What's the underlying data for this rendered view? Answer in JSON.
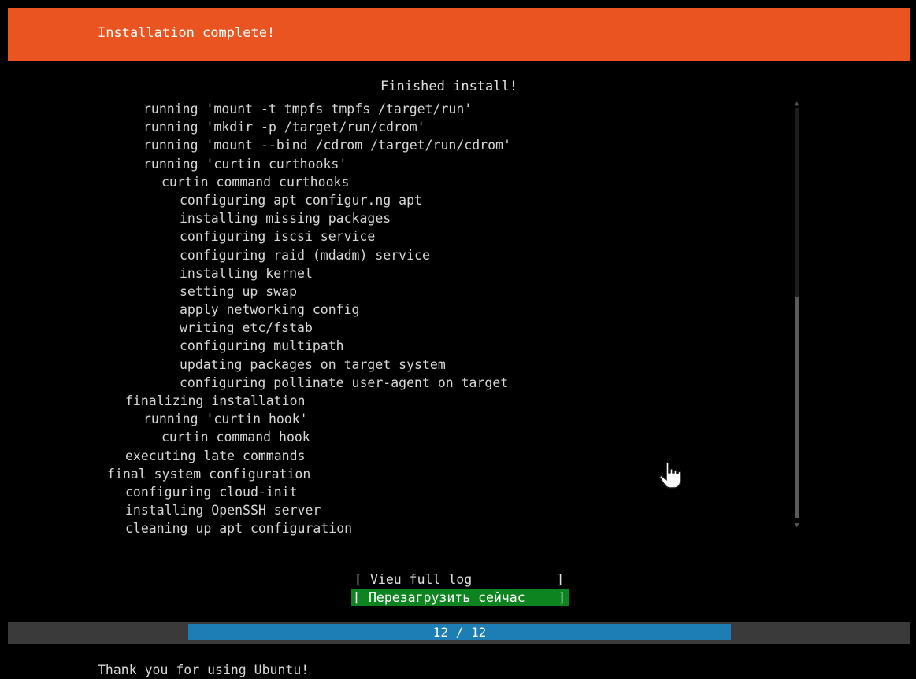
{
  "header": {
    "title": "Installation complete!",
    "color": "#e95420"
  },
  "dialog": {
    "title": "Finished install!",
    "log_lines": [
      {
        "indent": 2,
        "text": "running 'mount -t tmpfs tmpfs /target/run'"
      },
      {
        "indent": 2,
        "text": "running 'mkdir -p /target/run/cdrom'"
      },
      {
        "indent": 2,
        "text": "running 'mount --bind /cdrom /target/run/cdrom'"
      },
      {
        "indent": 2,
        "text": "running 'curtin curthooks'"
      },
      {
        "indent": 3,
        "text": "curtin command curthooks"
      },
      {
        "indent": 4,
        "text": "configuring apt configur.ng apt"
      },
      {
        "indent": 4,
        "text": "installing missing packages"
      },
      {
        "indent": 4,
        "text": "configuring iscsi service"
      },
      {
        "indent": 4,
        "text": "configuring raid (mdadm) service"
      },
      {
        "indent": 4,
        "text": "installing kernel"
      },
      {
        "indent": 4,
        "text": "setting up swap"
      },
      {
        "indent": 4,
        "text": "apply networking config"
      },
      {
        "indent": 4,
        "text": "writing etc/fstab"
      },
      {
        "indent": 4,
        "text": "configuring multipath"
      },
      {
        "indent": 4,
        "text": "updating packages on target system"
      },
      {
        "indent": 4,
        "text": "configuring pollinate user-agent on target"
      },
      {
        "indent": 1,
        "text": "finalizing installation"
      },
      {
        "indent": 2,
        "text": "running 'curtin hook'"
      },
      {
        "indent": 3,
        "text": "curtin command hook"
      },
      {
        "indent": 1,
        "text": "executing late commands"
      },
      {
        "indent": 0,
        "text": "final system configuration"
      },
      {
        "indent": 1,
        "text": "configuring cloud-init"
      },
      {
        "indent": 1,
        "text": "installing OpenSSH server"
      },
      {
        "indent": 1,
        "text": "cleaning up apt configuration"
      }
    ],
    "scroll": {
      "up_arrow": "▲",
      "down_arrow": "▼",
      "thumb_start_fraction": 0.46,
      "thumb_end_fraction": 1.0
    }
  },
  "buttons": {
    "bracket_left": "[",
    "bracket_right": "]",
    "view_log": "Vieu full log",
    "reboot": "Перезагрузить сейчас",
    "reboot_color": "#0e8420"
  },
  "progress": {
    "text": "12 / 12",
    "current": 12,
    "total": 12,
    "color": "#1d7eb6"
  },
  "footer": {
    "text": "Thank you for using Ubuntu!"
  },
  "cursor": {
    "icon": "hand-pointer-icon"
  }
}
